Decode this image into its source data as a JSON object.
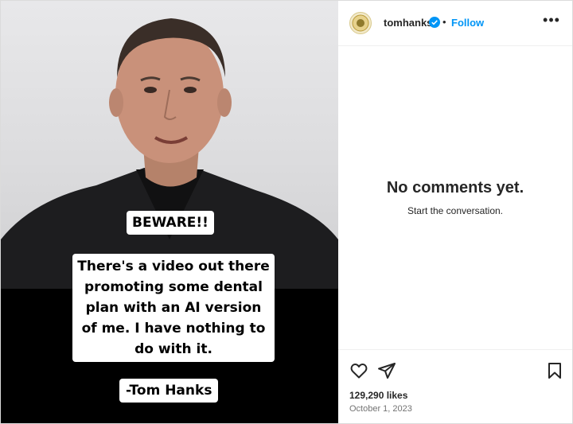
{
  "post": {
    "caption_beware": "BEWARE!!",
    "caption_body": "There's a video out there\npromoting some dental\nplan with an AI version\nof me.  I have nothing to\ndo with it.",
    "caption_signature": "-Tom Hanks"
  },
  "header": {
    "username": "tomhanks",
    "separator": "•",
    "follow_label": "Follow",
    "more_label": "•••"
  },
  "comments": {
    "empty_title": "No comments yet.",
    "empty_subtitle": "Start the conversation."
  },
  "footer": {
    "likes": "129,290 likes",
    "date": "October 1, 2023"
  },
  "colors": {
    "accent": "#0095f6",
    "verified": "#0095f6",
    "text": "#262626",
    "muted": "#737373"
  },
  "icons": {
    "like": "heart-icon",
    "share": "paper-plane-icon",
    "save": "bookmark-icon",
    "verified": "verified-badge-icon",
    "more": "more-options-icon"
  }
}
